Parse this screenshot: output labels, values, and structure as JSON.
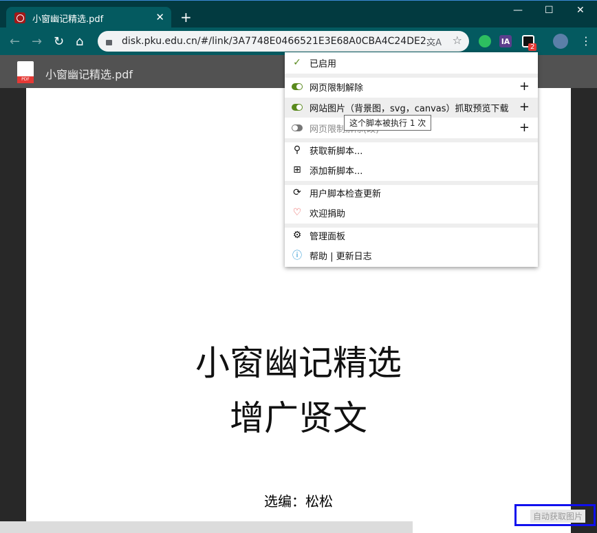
{
  "browser": {
    "tab_title": "小窗幽记精选.pdf",
    "url": "disk.pku.edu.cn/#/link/3A7748E0466521E3E68A0CBA4C24DE2...",
    "extension_badge": "2",
    "ext_ia": "IA"
  },
  "pdf": {
    "title": "小窗幽记精选.pdf",
    "icon_label": "PDF",
    "line1": "小窗幽记精选",
    "line2": "增广贤文",
    "editor": "选编：松松"
  },
  "menu": {
    "enabled": "已启用",
    "scripts": [
      {
        "label": "网页限制解除",
        "on": true
      },
      {
        "label": "网站图片（背景图，svg，canvas）抓取预览下载",
        "on": true
      },
      {
        "label": "网页限制解除(改)",
        "on": false
      }
    ],
    "tooltip": "这个脚本被执行 1 次",
    "get_scripts": "获取新脚本...",
    "add_script": "添加新脚本...",
    "check_updates": "用户脚本检查更新",
    "donate": "欢迎捐助",
    "dashboard": "管理面板",
    "help": "帮助 | 更新日志"
  },
  "auto_button": "自动获取图片",
  "colors": {
    "titlebar": "#023a40",
    "toolbar": "#045a60",
    "toggle_on": "#5a8a1e"
  }
}
